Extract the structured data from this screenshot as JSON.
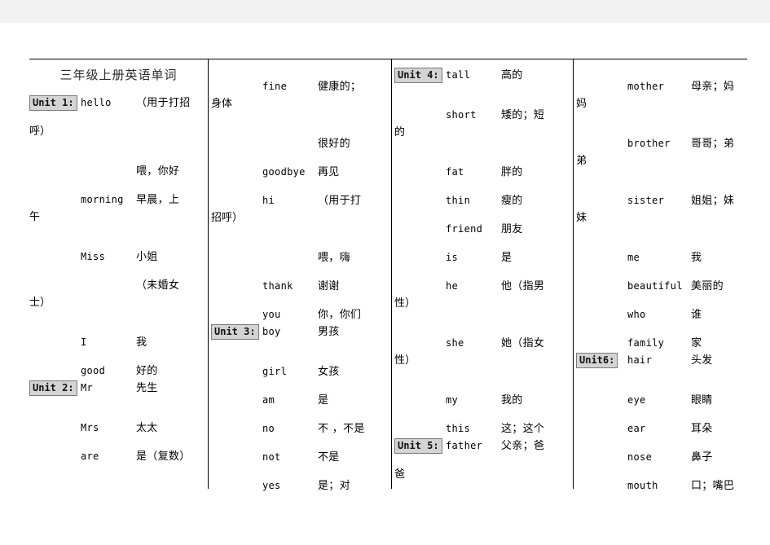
{
  "document": {
    "title": "三年级上册英语单词"
  },
  "columns": [
    {
      "name": "column-1",
      "rows": [
        {
          "type": "title",
          "text": "三年级上册英语单词"
        },
        {
          "type": "entry",
          "unit": "Unit 1:",
          "word": "hello",
          "translation": "（用于打招"
        },
        {
          "type": "cont",
          "text": "呼）"
        },
        {
          "type": "entry",
          "unit": "",
          "word": "",
          "translation": "喂，你好"
        },
        {
          "type": "entry",
          "unit": "",
          "word": "morning",
          "translation": "早晨，上"
        },
        {
          "type": "cont",
          "text": "午"
        },
        {
          "type": "entry",
          "unit": "",
          "word": "Miss",
          "translation": "小姐"
        },
        {
          "type": "entry",
          "unit": "",
          "word": "",
          "translation": "（未婚女"
        },
        {
          "type": "cont",
          "text": "士）"
        },
        {
          "type": "entry",
          "unit": "",
          "word": "I",
          "translation": "我"
        },
        {
          "type": "entry",
          "unit": "",
          "word": "good",
          "translation": "好的"
        },
        {
          "type": "entry",
          "unit": "Unit 2:",
          "word": "Mr",
          "translation": "先生"
        },
        {
          "type": "entry",
          "unit": "",
          "word": "Mrs",
          "translation": "太太"
        },
        {
          "type": "entry",
          "unit": "",
          "word": "are",
          "translation": "是（复数）"
        }
      ]
    },
    {
      "name": "column-2",
      "rows": [
        {
          "type": "entry",
          "unit": "",
          "word": "fine",
          "translation": "健康的；"
        },
        {
          "type": "cont",
          "text": "身体"
        },
        {
          "type": "entry",
          "unit": "",
          "word": "",
          "translation": "很好的"
        },
        {
          "type": "entry",
          "unit": "",
          "word": "goodbye",
          "translation": "再见"
        },
        {
          "type": "entry",
          "unit": "",
          "word": "hi",
          "translation": "（用于打"
        },
        {
          "type": "cont",
          "text": "招呼）"
        },
        {
          "type": "entry",
          "unit": "",
          "word": "",
          "translation": "喂，嗨"
        },
        {
          "type": "entry",
          "unit": "",
          "word": "thank",
          "translation": "谢谢"
        },
        {
          "type": "entry",
          "unit": "",
          "word": "you",
          "translation": "你，你们"
        },
        {
          "type": "entry",
          "unit": "Unit 3:",
          "word": "boy",
          "translation": "男孩"
        },
        {
          "type": "entry",
          "unit": "",
          "word": "girl",
          "translation": "女孩"
        },
        {
          "type": "entry",
          "unit": "",
          "word": "am",
          "translation": "是"
        },
        {
          "type": "entry",
          "unit": "",
          "word": "no",
          "translation": "不 ，不是"
        },
        {
          "type": "entry",
          "unit": "",
          "word": "not",
          "translation": "不是"
        },
        {
          "type": "entry",
          "unit": "",
          "word": "yes",
          "translation": "是；对"
        }
      ]
    },
    {
      "name": "column-3",
      "rows": [
        {
          "type": "entry",
          "unit": "Unit 4:",
          "word": "tall",
          "translation": "高的"
        },
        {
          "type": "entry",
          "unit": "",
          "word": "short",
          "translation": "矮的；短"
        },
        {
          "type": "cont",
          "text": "的"
        },
        {
          "type": "entry",
          "unit": "",
          "word": "fat",
          "translation": "胖的"
        },
        {
          "type": "entry",
          "unit": "",
          "word": "thin",
          "translation": "瘦的"
        },
        {
          "type": "entry",
          "unit": "",
          "word": "friend",
          "translation": "朋友"
        },
        {
          "type": "entry",
          "unit": "",
          "word": "is",
          "translation": "是"
        },
        {
          "type": "entry",
          "unit": "",
          "word": "he",
          "translation": "他（指男"
        },
        {
          "type": "cont",
          "text": "性）"
        },
        {
          "type": "entry",
          "unit": "",
          "word": "she",
          "translation": "她（指女"
        },
        {
          "type": "cont",
          "text": "性）"
        },
        {
          "type": "entry",
          "unit": "",
          "word": "my",
          "translation": "我的"
        },
        {
          "type": "entry",
          "unit": "",
          "word": "this",
          "translation": "这；这个"
        },
        {
          "type": "entry",
          "unit": "Unit 5:",
          "word": "father",
          "translation": "父亲；爸"
        },
        {
          "type": "cont",
          "text": "爸"
        }
      ]
    },
    {
      "name": "column-4",
      "rows": [
        {
          "type": "entry",
          "unit": "",
          "word": "mother",
          "translation": "母亲；妈"
        },
        {
          "type": "cont",
          "text": "妈"
        },
        {
          "type": "entry",
          "unit": "",
          "word": "brother",
          "translation": "哥哥；弟"
        },
        {
          "type": "cont",
          "text": "弟"
        },
        {
          "type": "entry",
          "unit": "",
          "word": "sister",
          "translation": "姐姐；妹"
        },
        {
          "type": "cont",
          "text": "妹"
        },
        {
          "type": "entry",
          "unit": "",
          "word": "me",
          "translation": "我"
        },
        {
          "type": "entry",
          "unit": "",
          "word": "beautiful",
          "translation": "美丽的"
        },
        {
          "type": "entry",
          "unit": "",
          "word": "who",
          "translation": "谁"
        },
        {
          "type": "entry",
          "unit": "",
          "word": "family",
          "translation": "家"
        },
        {
          "type": "entry",
          "unit": "Unit6:",
          "word": "hair",
          "translation": "头发"
        },
        {
          "type": "entry",
          "unit": "",
          "word": "eye",
          "translation": "眼睛"
        },
        {
          "type": "entry",
          "unit": "",
          "word": "ear",
          "translation": "耳朵"
        },
        {
          "type": "entry",
          "unit": "",
          "word": "nose",
          "translation": "鼻子"
        },
        {
          "type": "entry",
          "unit": "",
          "word": "mouth",
          "translation": "口；嘴巴"
        }
      ]
    }
  ],
  "style": {
    "page_background": "#f2f2f2",
    "document_background": "#ffffff",
    "rule_color": "#000000",
    "unit_badge_background": "#d4d4d4",
    "unit_badge_border": "#7a7a7a",
    "text_color": "#000000"
  }
}
